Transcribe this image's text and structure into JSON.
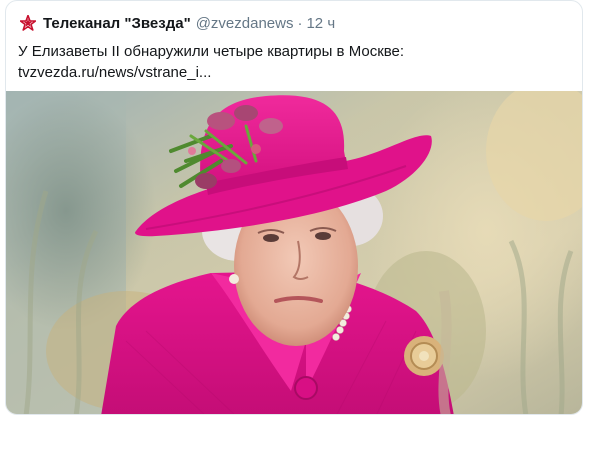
{
  "tweet": {
    "display_name": "Телеканал \"Звезда\"",
    "handle": "@zvezdanews",
    "separator": "·",
    "time": "12 ч",
    "text": "У Елизаветы II обнаружили четыре квартиры в Москве:",
    "link": "tvzvezda.ru/news/vstrane_i...",
    "brand_color": "#c8102e",
    "media_icon": "photo-image"
  }
}
